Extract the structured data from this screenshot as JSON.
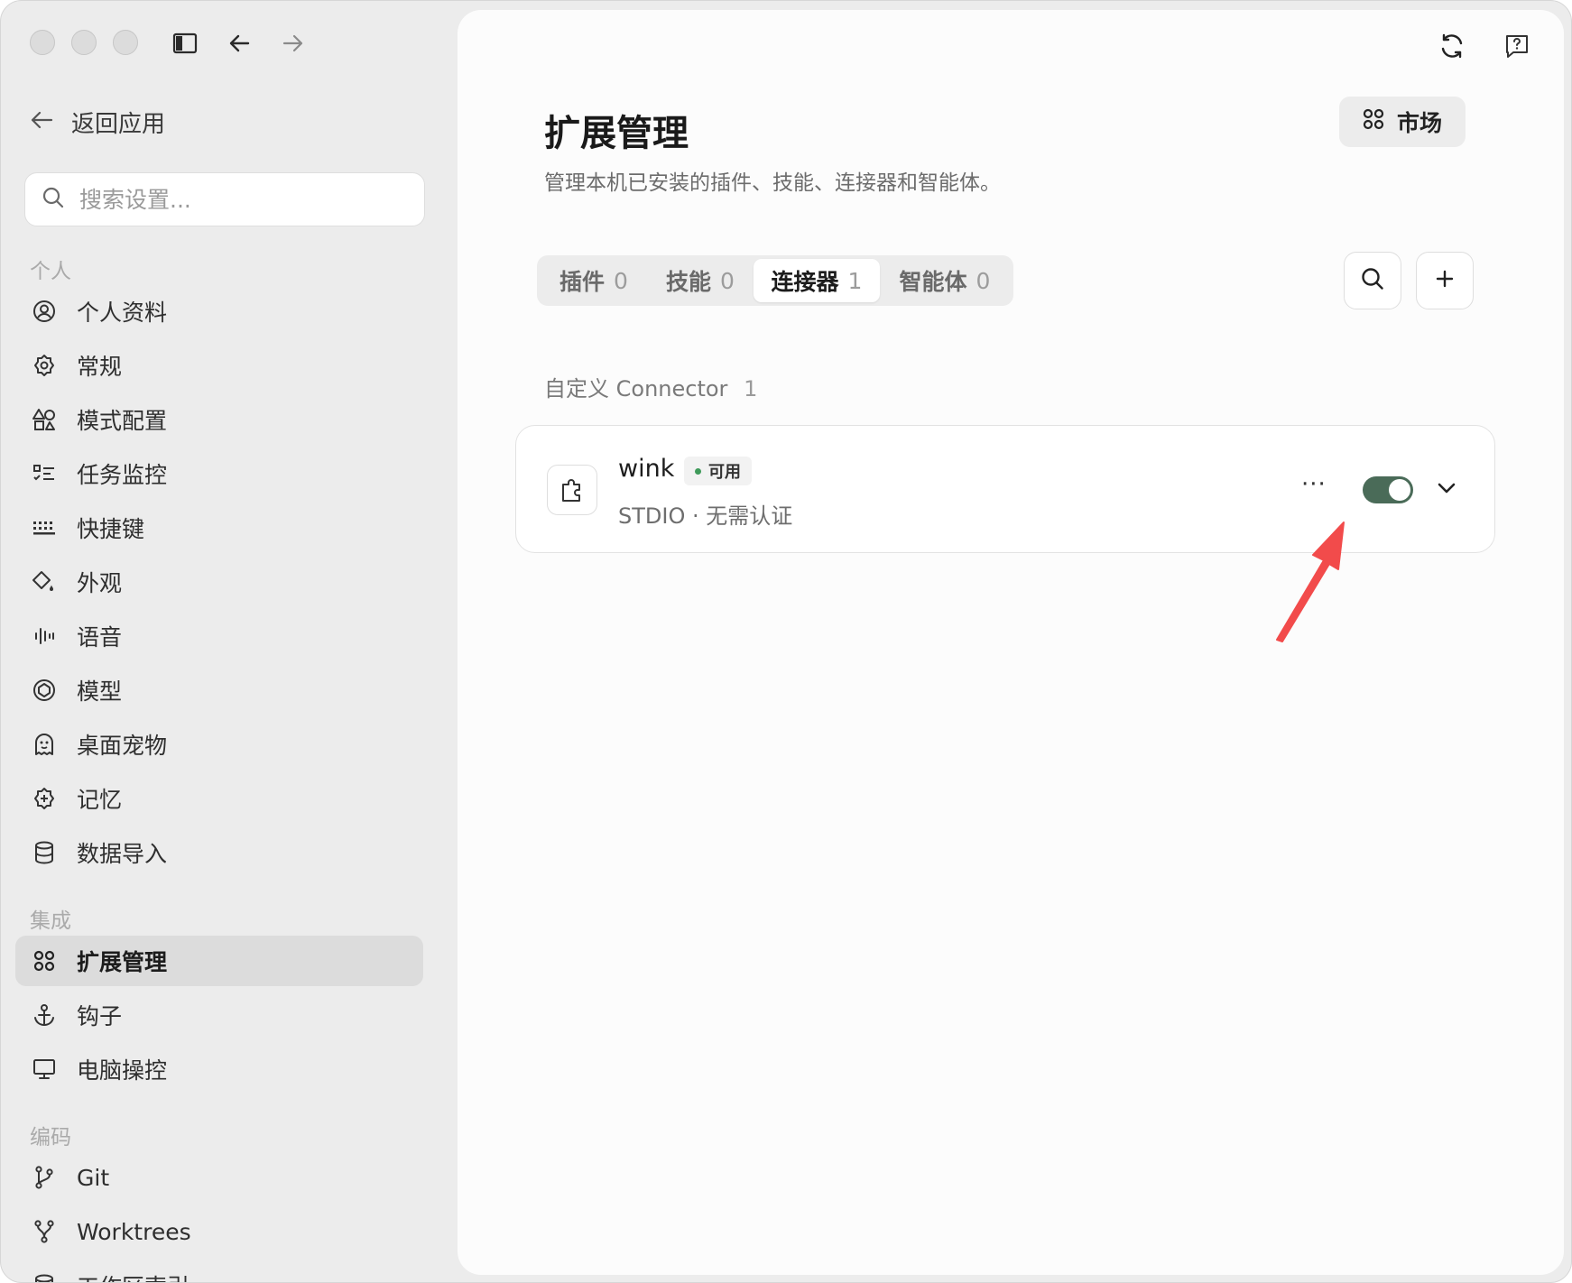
{
  "sidebar": {
    "back_label": "返回应用",
    "search_placeholder": "搜索设置...",
    "sections": {
      "personal": "个人",
      "integration": "集成",
      "coding": "编码"
    },
    "personal_items": [
      {
        "label": "个人资料",
        "icon": "user-circle-icon"
      },
      {
        "label": "常规",
        "icon": "gear-icon"
      },
      {
        "label": "模式配置",
        "icon": "shapes-icon"
      },
      {
        "label": "任务监控",
        "icon": "task-list-icon"
      },
      {
        "label": "快捷键",
        "icon": "keyboard-icon"
      },
      {
        "label": "外观",
        "icon": "paint-bucket-icon"
      },
      {
        "label": "语音",
        "icon": "audio-wave-icon"
      },
      {
        "label": "模型",
        "icon": "model-icon"
      },
      {
        "label": "桌面宠物",
        "icon": "ghost-icon"
      },
      {
        "label": "记忆",
        "icon": "brain-icon"
      },
      {
        "label": "数据导入",
        "icon": "database-icon"
      }
    ],
    "integration_items": [
      {
        "label": "扩展管理",
        "icon": "grid-icon",
        "active": true
      },
      {
        "label": "钩子",
        "icon": "anchor-icon"
      },
      {
        "label": "电脑操控",
        "icon": "monitor-icon"
      }
    ],
    "coding_items": [
      {
        "label": "Git",
        "icon": "git-branch-icon"
      },
      {
        "label": "Worktrees",
        "icon": "worktree-icon"
      },
      {
        "label": "工作区索引",
        "icon": "database-icon"
      }
    ]
  },
  "main": {
    "title": "扩展管理",
    "subtitle": "管理本机已安装的插件、技能、连接器和智能体。",
    "market_label": "市场",
    "tabs": [
      {
        "label": "插件",
        "count": "0"
      },
      {
        "label": "技能",
        "count": "0"
      },
      {
        "label": "连接器",
        "count": "1",
        "active": true
      },
      {
        "label": "智能体",
        "count": "0"
      }
    ],
    "group": {
      "label": "自定义 Connector",
      "count": "1"
    },
    "connector": {
      "name": "wink",
      "status": "可用",
      "meta": "STDIO · 无需认证",
      "more": "···",
      "enabled": true
    }
  },
  "colors": {
    "toggle_on": "#4a6b58",
    "status_dot": "#3f9a5a",
    "annotation_arrow": "#f24b4b"
  }
}
